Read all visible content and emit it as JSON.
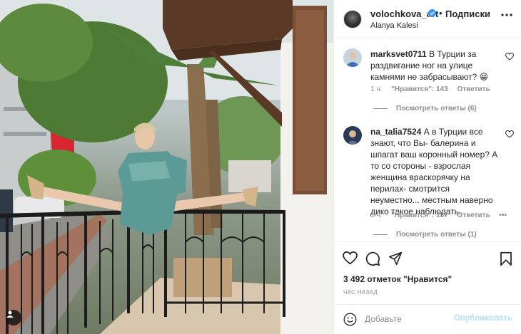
{
  "post": {
    "author": "volochkova_art",
    "verified": true,
    "separator": "•",
    "follow_label": "Подписки",
    "location": "Alanya Kalesi",
    "more_icon": "more-horizontal-icon"
  },
  "comments": [
    {
      "username": "marksvet0711",
      "text": "В Турции за раздвигание ног на улице камнями не забрасывают?",
      "emoji": "😁",
      "time": "1 ч.",
      "likes": "\"Нравится\": 143",
      "reply_label": "Ответить",
      "view_replies": "Посмотреть ответы (6)"
    },
    {
      "username": "na_talia7524",
      "text": "А в Турции все знают, что Вы- балерина и шпагат ваш коронный номер? А то со стороны - взрослая женщина враскорячку на перилах- смотрится неуместно... местным наверно дико такое наблюдать.",
      "time": "1 ч.",
      "likes": "\"Нравится\": 137",
      "reply_label": "Ответить",
      "options": "•••",
      "view_replies": "Посмотреть ответы (1)"
    }
  ],
  "actions": {
    "icons": [
      "heart-icon",
      "comment-icon",
      "share-icon",
      "bookmark-icon"
    ],
    "likes": "3 492 отметок \"Нравится\"",
    "time_ago": "ЧАС НАЗАД"
  },
  "add_comment": {
    "placeholder": "Добавьте",
    "publish_label": "Опубликовать",
    "emoji_icon": "smiley-icon"
  },
  "colors": {
    "text": "#262626",
    "muted": "#8e8e8e",
    "verified": "#3897f0",
    "publish_disabled": "#b2dffc",
    "divider": "#efefef"
  }
}
